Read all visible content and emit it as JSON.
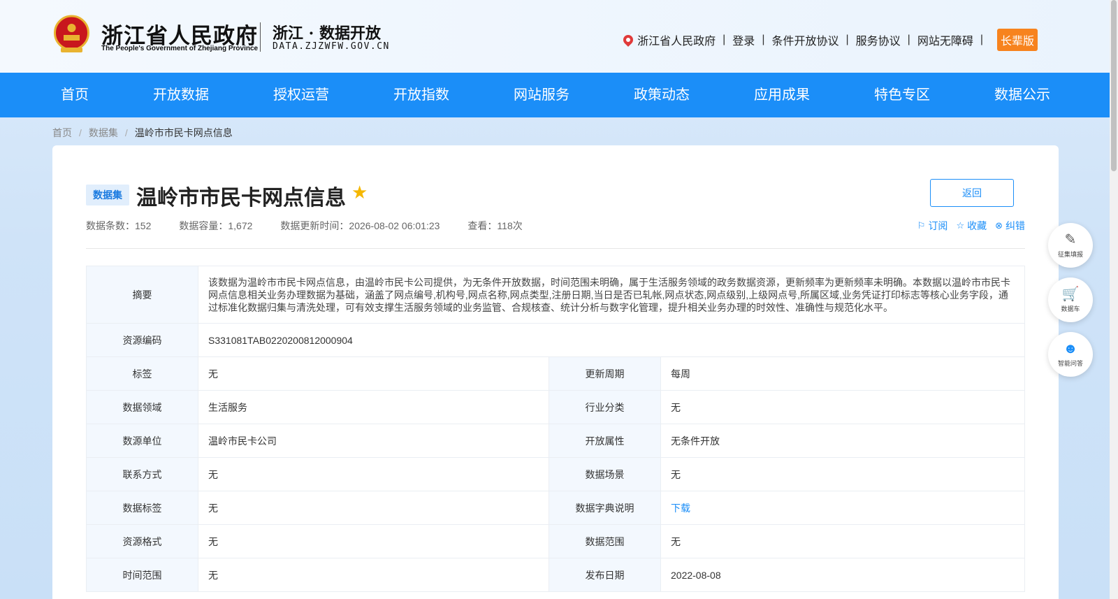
{
  "header": {
    "gov_title": "浙江省人民政府",
    "gov_subtitle": "The People's Government of Zhejiang Province",
    "platform_title": "浙江 · 数据开放",
    "platform_domain": "DATA.ZJZWFW.GOV.CN",
    "links": {
      "province": "浙江省人民政府",
      "login": "登录",
      "conditional_agreement": "条件开放协议",
      "service_agreement": "服务协议",
      "accessibility": "网站无障碍",
      "elder_mode": "长辈版"
    }
  },
  "nav": {
    "items": [
      "首页",
      "开放数据",
      "授权运营",
      "开放指数",
      "网站服务",
      "政策动态",
      "应用成果",
      "特色专区",
      "数据公示"
    ]
  },
  "breadcrumb": {
    "home": "首页",
    "datasets": "数据集",
    "current": "温岭市市民卡网点信息"
  },
  "dataset": {
    "badge": "数据集",
    "title": "温岭市市民卡网点信息",
    "back_label": "返回",
    "meta": {
      "count": "数据条数：152",
      "size": "数据容量：1,672",
      "updated": "数据更新时间：2026-08-02 06:01:23",
      "views": "查看：118次"
    },
    "actions": {
      "subscribe": "订阅",
      "favorite": "收藏",
      "report": "纠错"
    }
  },
  "info": {
    "summary_label": "摘要",
    "summary": "该数据为温岭市市民卡网点信息，由温岭市民卡公司提供，为无条件开放数据，时间范围未明确，属于生活服务领域的政务数据资源，更新频率为更新频率未明确。本数据以温岭市市民卡网点信息相关业务办理数据为基础，涵盖了网点编号,机构号,网点名称,网点类型,注册日期,当日是否已轧帐,网点状态,网点级别,上级网点号,所属区域,业务凭证打印标志等核心业务字段，通过标准化数据归集与清洗处理，可有效支撑生活服务领域的业务监管、合规核查、统计分析与数字化管理，提升相关业务办理的时效性、准确性与规范化水平。",
    "code_label": "资源编码",
    "code": "S331081TAB0220200812000904",
    "rows": [
      {
        "k1": "标签",
        "v1": "无",
        "k2": "更新周期",
        "v2": "每周"
      },
      {
        "k1": "数据领域",
        "v1": "生活服务",
        "k2": "行业分类",
        "v2": "无"
      },
      {
        "k1": "数源单位",
        "v1": "温岭市民卡公司",
        "k2": "开放属性",
        "v2": "无条件开放"
      },
      {
        "k1": "联系方式",
        "v1": "无",
        "k2": "数据场景",
        "v2": "无"
      },
      {
        "k1": "数据标签",
        "v1": "无",
        "k2": "数据字典说明",
        "v2": "下载"
      },
      {
        "k1": "资源格式",
        "v1": "无",
        "k2": "数据范围",
        "v2": "无"
      },
      {
        "k1": "时间范围",
        "v1": "无",
        "k2": "发布日期",
        "v2": "2022-08-08"
      }
    ]
  },
  "float": {
    "collect": "征集填报",
    "cart": "数据车",
    "qa": "智能问答"
  }
}
